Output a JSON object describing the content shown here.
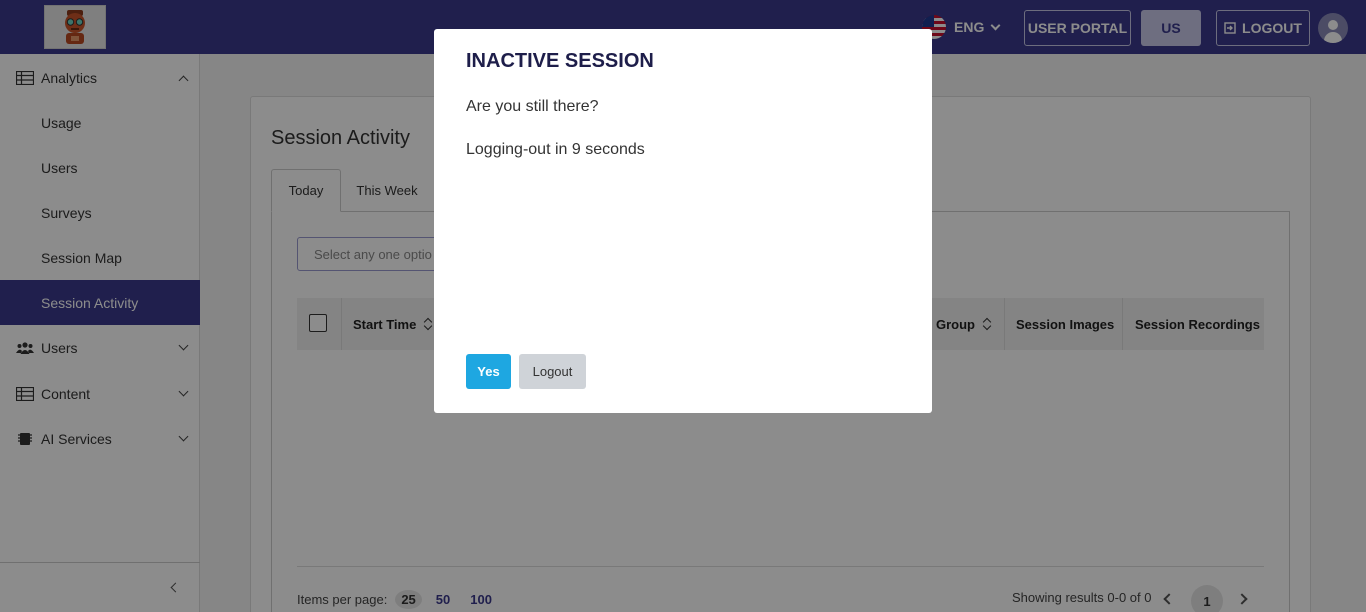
{
  "header": {
    "language": "ENG",
    "user_portal_label": "USER PORTAL",
    "region_label": "US",
    "logout_label": "LOGOUT"
  },
  "sidebar": {
    "items": [
      {
        "label": "Analytics",
        "icon": "table-icon"
      },
      {
        "label": "Usage"
      },
      {
        "label": "Users"
      },
      {
        "label": "Surveys"
      },
      {
        "label": "Session Map"
      },
      {
        "label": "Session Activity"
      },
      {
        "label": "Users",
        "icon": "users-icon"
      },
      {
        "label": "Content",
        "icon": "table-icon"
      },
      {
        "label": "AI Services",
        "icon": "chip-icon"
      }
    ]
  },
  "main": {
    "title": "Session Activity",
    "tabs": [
      {
        "label": "Today"
      },
      {
        "label": "This Week"
      }
    ],
    "select_placeholder": "Select any one optio",
    "columns": [
      "Start Time",
      "Group",
      "Session Images",
      "Session Recordings"
    ],
    "footer": {
      "items_per_page_label": "Items per page:",
      "page_sizes": [
        "25",
        "50",
        "100"
      ],
      "results": "Showing results 0-0 of 0",
      "current_page": "1"
    }
  },
  "modal": {
    "title": "INACTIVE SESSION",
    "question": "Are you still there?",
    "message": "Logging-out in 9 seconds",
    "yes_label": "Yes",
    "logout_label": "Logout"
  },
  "colors": {
    "brand": "#3b3a8c",
    "accent": "#1ea7e1"
  }
}
